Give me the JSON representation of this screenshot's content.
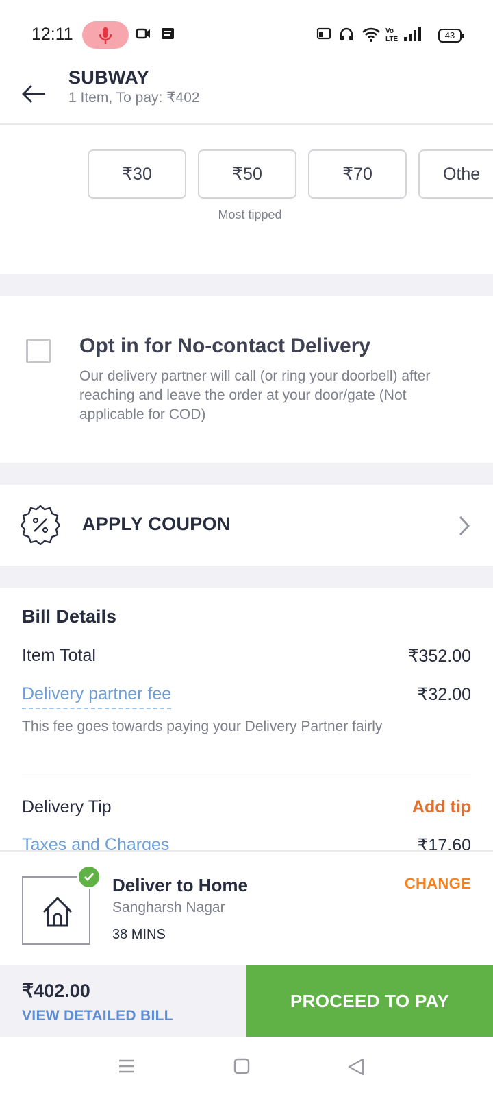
{
  "status_bar": {
    "time": "12:11",
    "battery": "43"
  },
  "header": {
    "title": "SUBWAY",
    "subtitle": "1 Item, To pay: ₹402"
  },
  "tip": {
    "options": [
      "₹30",
      "₹50",
      "₹70",
      "Othe"
    ],
    "most_tipped_label": "Most tipped"
  },
  "no_contact": {
    "title": "Opt in for No-contact Delivery",
    "description": "Our delivery partner will call (or ring your doorbell) after reaching and leave the order at your door/gate (Not applicable for COD)",
    "checked": false
  },
  "coupon": {
    "label": "APPLY COUPON"
  },
  "bill": {
    "title": "Bill Details",
    "item_total_label": "Item Total",
    "item_total_value": "₹352.00",
    "delivery_fee_label": "Delivery partner fee",
    "delivery_fee_value": "₹32.00",
    "delivery_fee_note": "This fee goes towards paying your Delivery Partner fairly",
    "delivery_tip_label": "Delivery Tip",
    "delivery_tip_action": "Add tip",
    "taxes_label": "Taxes and Charges",
    "taxes_value": "₹17.60"
  },
  "delivery": {
    "title": "Deliver to Home",
    "address": "Sangharsh Nagar",
    "eta": "38 MINS",
    "change_label": "CHANGE"
  },
  "pay": {
    "amount": "₹402.00",
    "view_bill_label": "VIEW DETAILED BILL",
    "proceed_label": "PROCEED TO PAY"
  },
  "colors": {
    "accent_green": "#60b246",
    "accent_orange": "#fc8019",
    "link_blue": "#6d9fd6"
  }
}
